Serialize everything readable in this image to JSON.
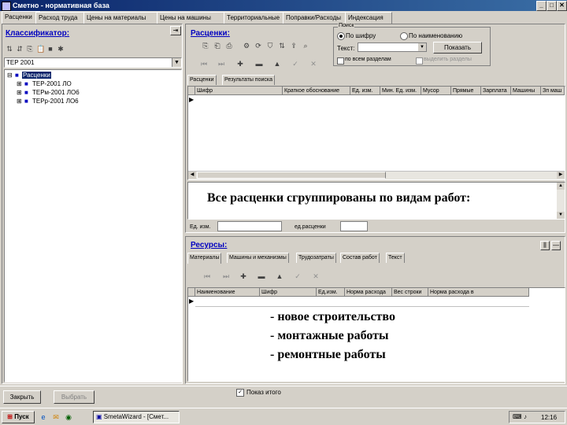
{
  "window": {
    "title": "Сметно - нормативная база"
  },
  "main_tabs": [
    {
      "label": "Расценки"
    },
    {
      "label": "Расход труда"
    },
    {
      "label": "Цены на материалы"
    },
    {
      "label": "Цены на машины"
    },
    {
      "label": "Территориальные"
    },
    {
      "label": "Поправки/Расходы"
    },
    {
      "label": "Индексация"
    }
  ],
  "classifier": {
    "header": "Классификатор:",
    "select_value": "ТЕР 2001",
    "tree": [
      {
        "label": "Расценки"
      },
      {
        "label": "ТЕР-2001 ЛО"
      },
      {
        "label": "ТЕРм-2001 ЛО6"
      },
      {
        "label": "ТЕРр-2001 ЛО6"
      }
    ]
  },
  "rates": {
    "header": "Расценки:",
    "search": {
      "group_label": "Поиск",
      "radio_code": "По шифру",
      "radio_name": "По наименованию",
      "text_label": "Текст:",
      "find_button": "Показать",
      "chk_all_sections": "по всем разделам",
      "chk_exclude": "выделить разделы"
    },
    "sub_tabs": [
      {
        "label": "Расценки"
      },
      {
        "label": "Результаты поиска"
      }
    ],
    "columns": [
      "Шифр",
      "Краткое обоснование",
      "Ед. изм.",
      "Мин. Ед. изм.",
      "Мусор",
      "Прямые",
      "Зарплата",
      "Машины",
      "Зп маш"
    ],
    "caption": "Все расценки сгруппированы по видам работ:",
    "unit_label": "Ед. изм.",
    "per_label": "ед.расценки"
  },
  "resources": {
    "header": "Ресурсы:",
    "tabs": [
      {
        "label": "Материалы"
      },
      {
        "label": "Машины и механизмы"
      },
      {
        "label": "Трудозатраты"
      },
      {
        "label": "Состав работ"
      },
      {
        "label": "Текст"
      }
    ],
    "columns": [
      "Наименование",
      "Шифр",
      "Ед.изм.",
      "Норма расхода",
      "Вес строки",
      "Норма расхода в"
    ],
    "lines": [
      "- новое строительство",
      "- монтажные работы",
      "- ремонтные работы"
    ]
  },
  "footer": {
    "close_button": "Закрыть",
    "extra_button": "Выбрать",
    "checkbox_label": "Показ итого"
  },
  "taskbar": {
    "start": "Пуск",
    "task": "SmetaWizard - [Смет...",
    "clock": "12:16"
  }
}
